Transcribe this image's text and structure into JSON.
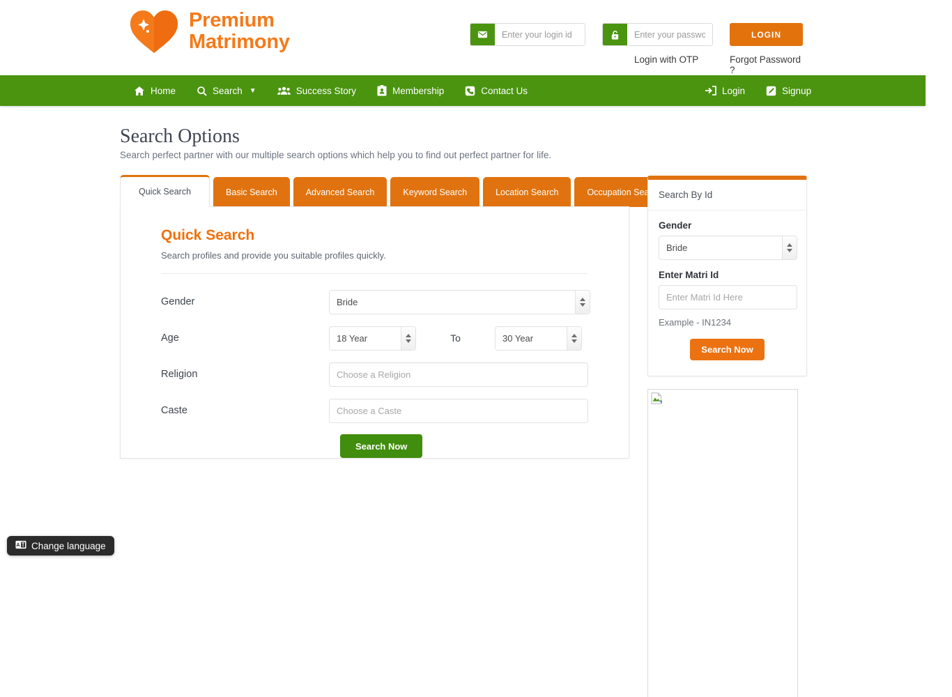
{
  "brand": {
    "name_line1": "Premium",
    "name_line2": "Matrimony",
    "logo_icon": "heart-sparkle-icon",
    "accent_orange": "#f47a1a",
    "accent_green": "#4a9410"
  },
  "header": {
    "login_id": {
      "placeholder": "Enter your login id",
      "value": "",
      "icon": "envelope-icon"
    },
    "password": {
      "placeholder": "Enter your password",
      "value": "",
      "icon": "lock-icon"
    },
    "login_button": "LOGIN",
    "otp_link": "Login with OTP",
    "forgot_link": "Forgot Password ?"
  },
  "nav": {
    "left": [
      {
        "label": "Home",
        "icon": "home-icon",
        "caret": false
      },
      {
        "label": "Search",
        "icon": "search-icon",
        "caret": true
      },
      {
        "label": "Success Story",
        "icon": "users-icon",
        "caret": false
      },
      {
        "label": "Membership",
        "icon": "id-card-icon",
        "caret": false
      },
      {
        "label": "Contact Us",
        "icon": "phone-icon",
        "caret": false
      }
    ],
    "right": [
      {
        "label": "Login",
        "icon": "sign-in-icon"
      },
      {
        "label": "Signup",
        "icon": "edit-icon"
      }
    ]
  },
  "page": {
    "title": "Search Options",
    "subtitle": "Search perfect partner with our multiple search options which help you to find out perfect partner for life."
  },
  "tabs": [
    {
      "label": "Quick Search",
      "active": true
    },
    {
      "label": "Basic Search",
      "active": false
    },
    {
      "label": "Advanced Search",
      "active": false
    },
    {
      "label": "Keyword Search",
      "active": false
    },
    {
      "label": "Location Search",
      "active": false
    },
    {
      "label": "Occupation Search",
      "active": false
    }
  ],
  "quick_search": {
    "heading": "Quick Search",
    "description": "Search profiles and provide you suitable profiles quickly.",
    "gender_label": "Gender",
    "gender_value": "Bride",
    "age_label": "Age",
    "age_from_value": "18 Year",
    "age_to_label": "To",
    "age_to_value": "30 Year",
    "religion_label": "Religion",
    "religion_placeholder": "Choose a Religion",
    "religion_value": "",
    "caste_label": "Caste",
    "caste_placeholder": "Choose a Caste",
    "caste_value": "",
    "submit_label": "Search Now"
  },
  "search_by_id": {
    "header": "Search By Id",
    "gender_label": "Gender",
    "gender_value": "Bride",
    "matri_id_label": "Enter Matri Id",
    "matri_id_placeholder": "Enter Matri Id Here",
    "matri_id_value": "",
    "example_note": "Example - IN1234",
    "submit_label": "Search Now"
  },
  "ad": {
    "alt": "broken-image-placeholder"
  },
  "language_pill": {
    "label": "Change language",
    "icon": "translate-icon"
  }
}
